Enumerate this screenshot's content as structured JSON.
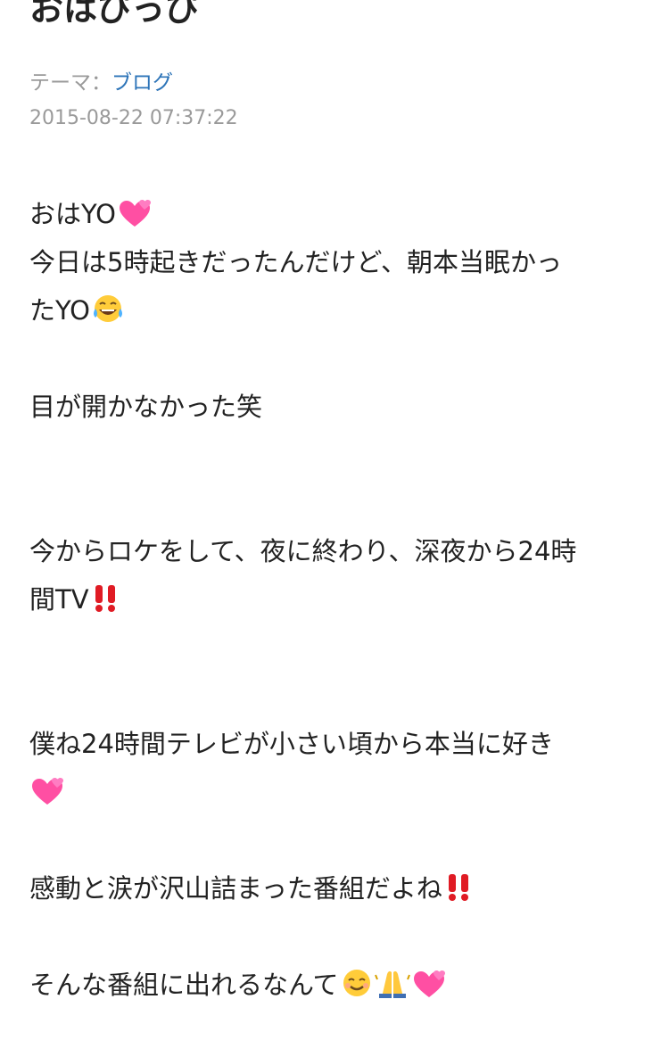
{
  "post": {
    "title": "おはぴっぴ",
    "theme_label": "テーマ：",
    "theme_link": "ブログ",
    "date": "2015-08-22 07:37:22"
  },
  "body": {
    "line1": "おはYO",
    "line2": "今日は5時起きだったんだけど、朝本当眠かっ",
    "line3": "たYO",
    "line4": "目が開かなかった笑",
    "line5": "今からロケをして、夜に終わり、深夜から24時",
    "line6": "間TV",
    "line7": "僕ね24時間テレビが小さい頃から本当に好き",
    "line8": "感動と涙が沢山詰まった番組だよね",
    "line9": "そんな番組に出れるなんて"
  },
  "colors": {
    "text": "#222222",
    "meta": "#9a9a9a",
    "link": "#2d74b8",
    "heart": "#ff4fa3",
    "exclaim": "#e01b24"
  },
  "icons": [
    "two-hearts-icon",
    "tears-of-joy-icon",
    "double-exclamation-icon",
    "smiling-face-icon",
    "folded-hands-icon"
  ]
}
